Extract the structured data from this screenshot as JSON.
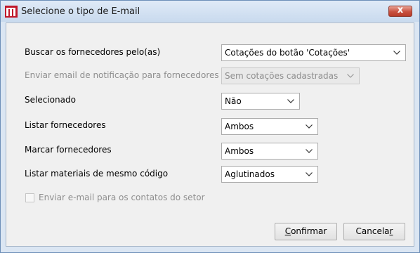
{
  "window": {
    "title": "Selecione o tipo de E-mail",
    "close_label": "x"
  },
  "form": {
    "rows": [
      {
        "label": "Buscar os fornecedores pelo(as)",
        "value": "Cotações do botão 'Cotações'",
        "enabled": true
      },
      {
        "label": "Enviar email de notificação para fornecedores",
        "value": "Sem cotações cadastradas",
        "enabled": false
      },
      {
        "label": "Selecionado",
        "value": "Não",
        "enabled": true
      },
      {
        "label": "Listar fornecedores",
        "value": "Ambos",
        "enabled": true
      },
      {
        "label": "Marcar fornecedores",
        "value": "Ambos",
        "enabled": true
      },
      {
        "label": "Listar materiais de mesmo código",
        "value": "Aglutinados",
        "enabled": true
      }
    ],
    "checkbox": {
      "label": "Enviar e-mail para os contatos do setor",
      "checked": false,
      "enabled": false
    }
  },
  "buttons": {
    "confirm": {
      "before": "",
      "mnemonic": "C",
      "after": "onfirmar"
    },
    "cancel": {
      "before": "Cancela",
      "mnemonic": "r",
      "after": ""
    }
  },
  "colors": {
    "title_bar": "#c9daee",
    "close_button": "#c8503f",
    "dialog_background": "#f0f0f0",
    "disabled_text": "#8e8e8e",
    "app_icon": "#c0182b"
  },
  "icons": {
    "app": "app-logo-icon",
    "close": "close-icon",
    "dropdown": "chevron-down-icon"
  }
}
